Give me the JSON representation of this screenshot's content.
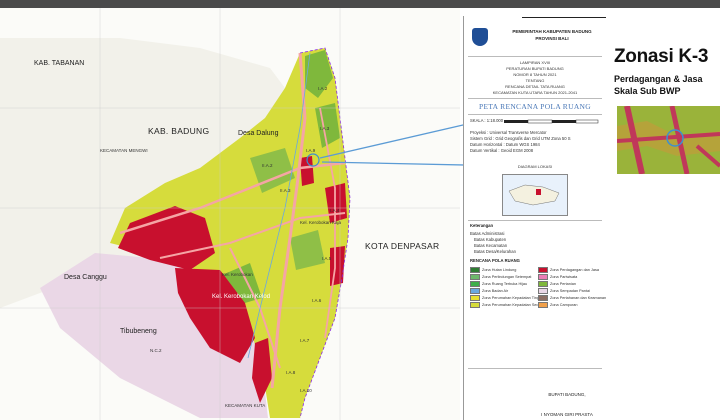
{
  "map": {
    "labels": {
      "kab_tabanan": "KAB. TABANAN",
      "kab_badung": "KAB. BADUNG",
      "kota_denpasar": "KOTA DENPASAR",
      "desa_dalung": "Desa Dalung",
      "kerobokan_kaja": "Kel. Kerobokan Kaja",
      "kerobokan": "Kel. Kerobokan",
      "desa_canggu": "Desa Canggu",
      "tibubeneng": "Tibubeneng",
      "kerobokan_kelod": "Kel. Kerobokan Kelod",
      "kec_mengwi": "KECAMATAN MENGWI",
      "kec_kuta": "KECAMATAN KUTA",
      "block_iia2": "II.A.2",
      "block_iia3": "II.A.3",
      "block_ia2": "I.A.2",
      "block_ia3": "I.A.3",
      "block_ia4": "I.A.4",
      "block_ia5": "I.A.5",
      "block_ia6": "I.A.6",
      "block_ia7": "I.A.7",
      "block_ia8": "I.A.8",
      "block_ia9": "I.A.9",
      "block_ia10": "I.A.10",
      "block_nc2": "N.C.2"
    },
    "colors": {
      "residential": "#d6dc3c",
      "commercial": "#c8102e",
      "agriculture": "#7fb83c",
      "beach": "#ead7e6",
      "road": "#f5a5a5",
      "sea": "#ffffff",
      "river": "#6aa9df"
    }
  },
  "legend_panel": {
    "header_lines": [
      "PEMERINTAH KABUPATEN BADUNG",
      "PROVINSI BALI"
    ],
    "regulation_lines": [
      "LAMPIRAN XVIII",
      "PERATURAN BUPATI BADUNG",
      "NOMOR 8 TAHUN 2021",
      "TENTANG",
      "RENCANA DETAIL TATA RUANG",
      "KECAMATAN KUTA UTARA TAHUN 2021-2041"
    ],
    "map_title": "PETA RENCANA POLA RUANG",
    "scale": "SKALA : 1:18.000",
    "info": [
      "Proyeksi : Universal Transverse Mercator",
      "Sistem Grid : Grid Geografis dan Grid UTM Zona 50 S",
      "Datum Horizontal : Datum WGS 1984",
      "Datum Vertikal : Geoid EGM 2008"
    ],
    "inset_label": "DIAGRAM LOKASI",
    "legend_heading": "Keterangan",
    "boundary_items": [
      "Batas Administrasi",
      "Batas Kabupaten",
      "Batas Kecamatan",
      "Batas Desa/Kelurahan"
    ],
    "pola_ruang_heading": "RENCANA POLA RUANG",
    "zones": [
      {
        "label": "Zona Hutan Lindung",
        "color": "#2e7d32"
      },
      {
        "label": "Zona Perlindungan Setempat",
        "color": "#6db86b"
      },
      {
        "label": "Zona Ruang Terbuka Hijau",
        "color": "#3fae49"
      },
      {
        "label": "Zona Badan Air",
        "color": "#6aa9df"
      },
      {
        "label": "Zona Perumahan Kepadatan Tinggi",
        "color": "#e8e030"
      },
      {
        "label": "Zona Perumahan Kepadatan Sedang",
        "color": "#d6dc3c"
      },
      {
        "label": "Zona Perdagangan dan Jasa",
        "color": "#c8102e"
      },
      {
        "label": "Zona Pariwisata",
        "color": "#ea7db6"
      },
      {
        "label": "Zona Pertanian",
        "color": "#7fb83c"
      },
      {
        "label": "Zona Sempadan Pantai",
        "color": "#ead7e6"
      },
      {
        "label": "Zona Pertahanan dan Keamanan",
        "color": "#8d6e63"
      },
      {
        "label": "Zona Campuran",
        "color": "#f0a04b"
      }
    ],
    "signature_title": "BUPATI BADUNG,",
    "signature_name": "I NYOMAN GIRI PRASTA"
  },
  "zone_panel": {
    "title": "Zonasi K-3",
    "subtitle_1": "Perdagangan & Jasa",
    "subtitle_2": "Skala Sub BWP"
  }
}
